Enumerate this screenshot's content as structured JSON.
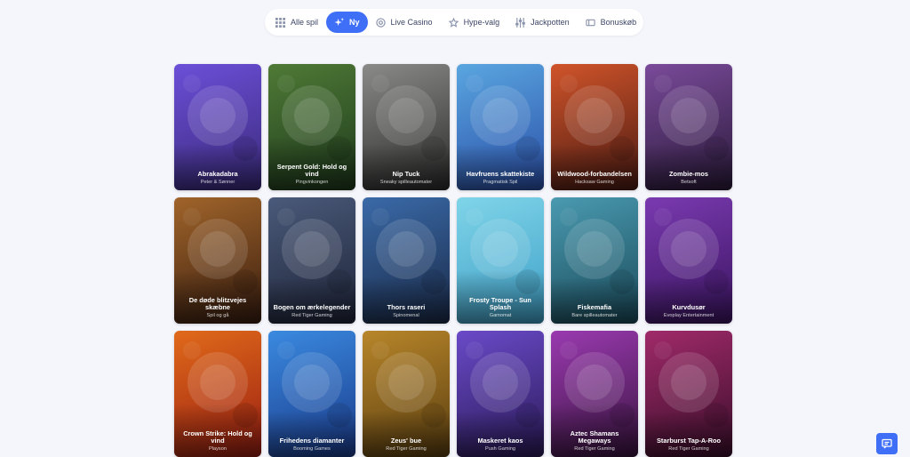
{
  "nav": {
    "tabs": [
      {
        "label": "Alle spil",
        "icon": "grid-icon",
        "active": false
      },
      {
        "label": "Ny",
        "icon": "sparkle-icon",
        "active": true
      },
      {
        "label": "Live Casino",
        "icon": "chip-icon",
        "active": false
      },
      {
        "label": "Hype-valg",
        "icon": "star-icon",
        "active": false
      },
      {
        "label": "Jackpotten",
        "icon": "sliders-icon",
        "active": false
      },
      {
        "label": "Bonuskøb",
        "icon": "ticket-icon",
        "active": false
      }
    ]
  },
  "games": [
    {
      "title": "Abrakadabra",
      "provider": "Peter & Sønner",
      "c1": "#6c4fd8",
      "c2": "#3a2a7a"
    },
    {
      "title": "Serpent Gold: Hold og vind",
      "provider": "Pingvinkongen",
      "c1": "#4f7a36",
      "c2": "#1e3a1c"
    },
    {
      "title": "Nip Tuck",
      "provider": "Sneaky spilleautomater",
      "c1": "#8a8a88",
      "c2": "#2a2a2a"
    },
    {
      "title": "Havfruens skattekiste",
      "provider": "Pragmatisk Spil",
      "c1": "#5aa6e0",
      "c2": "#2a4fa8"
    },
    {
      "title": "Wildwood-forbandelsen",
      "provider": "Hacksaw Gaming",
      "c1": "#d0542a",
      "c2": "#4a1a12"
    },
    {
      "title": "Zombie-mos",
      "provider": "Betsoft",
      "c1": "#7a4a9a",
      "c2": "#2a1a3a"
    },
    {
      "title": "De døde blitzvejes skæbne",
      "provider": "Spil og gå",
      "c1": "#a0642a",
      "c2": "#3a1e10"
    },
    {
      "title": "Bogen om ærkelegender",
      "provider": "Red Tiger Gaming",
      "c1": "#4a5a7a",
      "c2": "#1e2438"
    },
    {
      "title": "Thors raseri",
      "provider": "Spinomenal",
      "c1": "#3a6aa8",
      "c2": "#1a2a48"
    },
    {
      "title": "Frosty Troupe - Sun Splash",
      "provider": "Gamomat",
      "c1": "#7fd4e8",
      "c2": "#3fa0c8"
    },
    {
      "title": "Fiskemafia",
      "provider": "Bare spilleautomater",
      "c1": "#4a9ab0",
      "c2": "#1a4a5a"
    },
    {
      "title": "Kurvdusør",
      "provider": "Evoplay Entertainment",
      "c1": "#7a3ab0",
      "c2": "#3a1460"
    },
    {
      "title": "Crown Strike: Hold og vind",
      "provider": "Playson",
      "c1": "#e06a1a",
      "c2": "#9a1e12"
    },
    {
      "title": "Frihedens diamanter",
      "provider": "Booming Games",
      "c1": "#3a8ae0",
      "c2": "#1a3a8a"
    },
    {
      "title": "Zeus' bue",
      "provider": "Red Tiger Gaming",
      "c1": "#b8862a",
      "c2": "#5a3e10"
    },
    {
      "title": "Maskeret kaos",
      "provider": "Push Gaming",
      "c1": "#6a4ac8",
      "c2": "#2a1a58"
    },
    {
      "title": "Aztec Shamans Megaways",
      "provider": "Red Tiger Gaming",
      "c1": "#9a3ab0",
      "c2": "#3a1440"
    },
    {
      "title": "Starburst Tap-A-Roo",
      "provider": "Red Tiger Gaming",
      "c1": "#a02a6a",
      "c2": "#3a0e2a"
    }
  ],
  "colors": {
    "accent": "#3f6ff6",
    "background": "#f5f6fb"
  }
}
